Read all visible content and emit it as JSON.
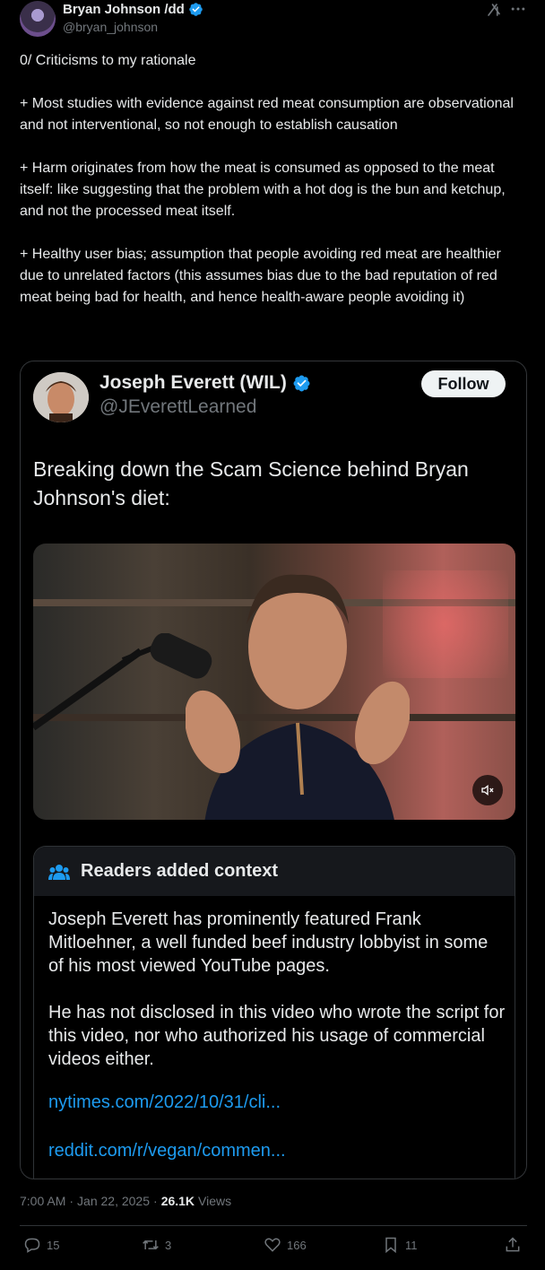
{
  "author": {
    "name": "Bryan Johnson /dd",
    "handle": "@bryan_johnson",
    "verified": true
  },
  "tweet": {
    "text": "0/ Criticisms to my rationale\n\n+ Most studies with evidence against red meat consumption are observational and not interventional, so not enough to establish causation\n\n+ Harm originates from how the meat is consumed as opposed to the meat itself: like suggesting that the problem with a hot dog is the bun and ketchup, and not the processed meat itself.\n\n+ Healthy user bias; assumption that people avoiding red meat are healthier due to unrelated factors (this assumes bias due to the bad reputation of red meat being bad for health, and hence health-aware people avoiding it)"
  },
  "quoted": {
    "name": "Joseph Everett (WIL)",
    "handle": "@JEverettLearned",
    "follow_label": "Follow",
    "text": "Breaking down the Scam Science behind Bryan Johnson's diet:",
    "video": {
      "muted": true
    }
  },
  "context_note": {
    "title": "Readers added context",
    "paragraph1": "Joseph Everett has prominently featured Frank Mitloehner, a well funded beef industry lobbyist in some of his most viewed YouTube pages.",
    "paragraph2": "He has not disclosed in this video who wrote the script for this video, nor who authorized his usage of commercial videos either.",
    "link1": "nytimes.com/2022/10/31/cli...",
    "link2": "reddit.com/r/vegan/commen..."
  },
  "meta": {
    "time": "7:00 AM",
    "sep1": "·",
    "date": "Jan 22, 2025",
    "sep2": "·",
    "views_count": "26.1K",
    "views_label": "Views"
  },
  "actions": {
    "replies": "15",
    "retweets": "3",
    "likes": "166",
    "bookmarks": "11"
  },
  "colors": {
    "background": "#000000",
    "text": "#e7e9ea",
    "muted": "#71767b",
    "link": "#1d9bf0",
    "verified": "#1d9bf0"
  },
  "icons": [
    "verified-badge-icon",
    "grok-icon",
    "more-icon",
    "mute-icon",
    "readers-icon",
    "reply-icon",
    "retweet-icon",
    "like-icon",
    "bookmark-icon",
    "share-icon"
  ]
}
